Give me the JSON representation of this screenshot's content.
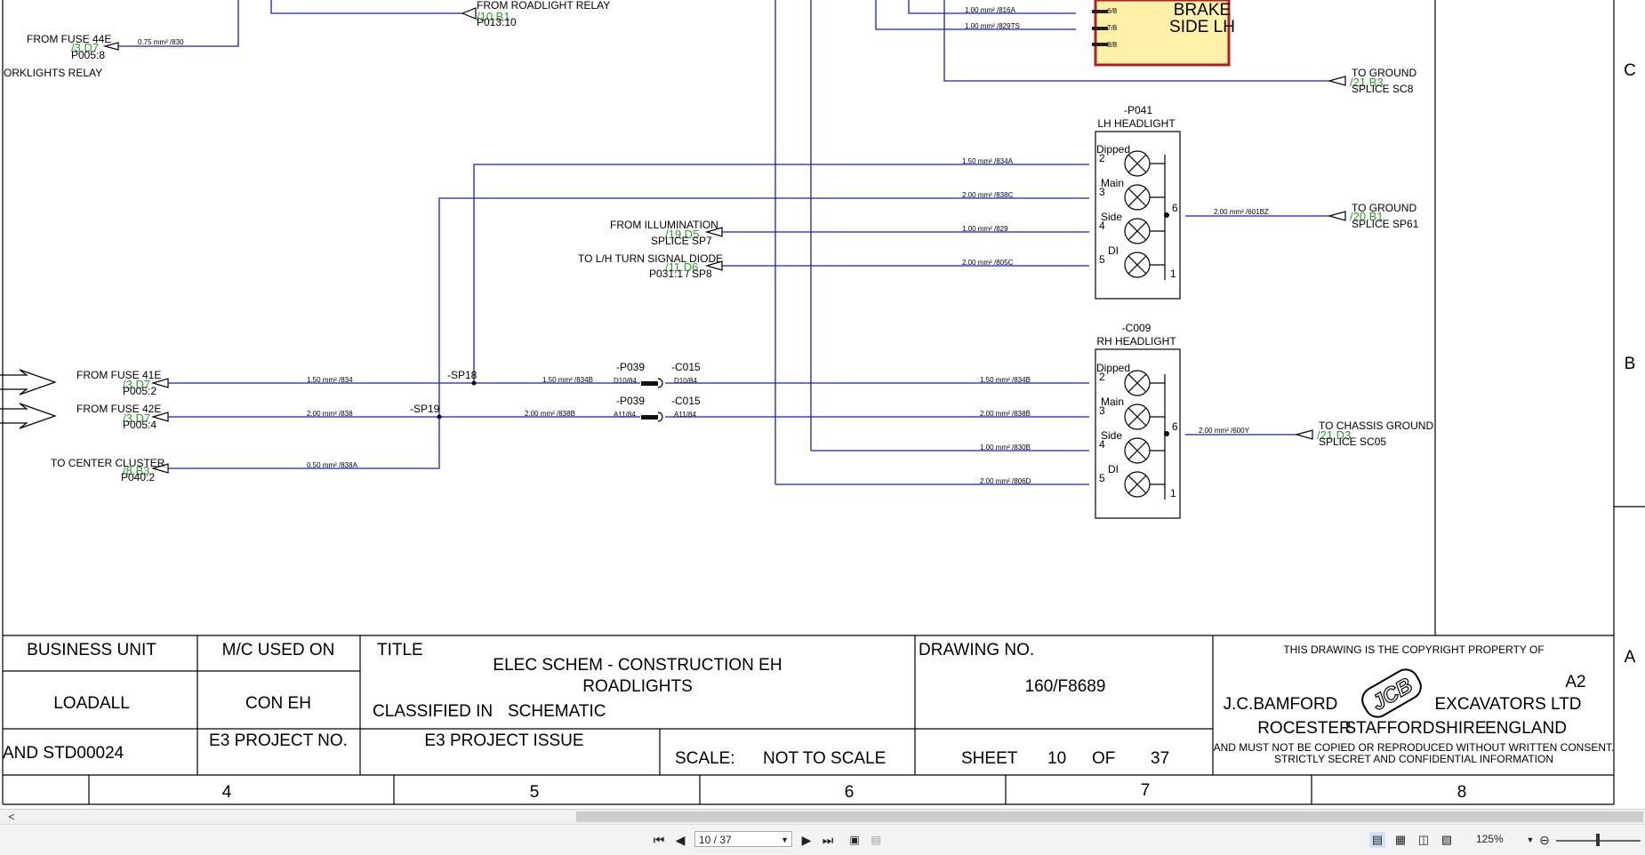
{
  "schematic": {
    "top_labels": {
      "from_roadlight_relay": "FROM ROADLIGHT RELAY",
      "roadlight_ref": "/10.B1",
      "roadlight_pin": "P013:10",
      "from_fuse_44e": "FROM FUSE 44E",
      "fuse44_ref": "/3.D7",
      "fuse44_pin": "P005:8",
      "fuse44_wire": "0.75 mm² /830",
      "worklights_relay": "ORKLIGHTS RELAY",
      "brake": "BRAKE",
      "side_lh": "SIDE LH",
      "pin_6_8": "6/8",
      "pin_7_8": "7/8",
      "pin_8_8": "8/8",
      "wire_816a": "1.00 mm² /816A",
      "wire_829ts": "1.00 mm² /829TS",
      "to_ground_1": "TO GROUND",
      "ground1_ref": "/21.B3",
      "ground1_splice": "SPLICE SC8"
    },
    "lh_headlight": {
      "ref": "-P041",
      "name": "LH HEADLIGHT",
      "pins": [
        {
          "name": "Dipped",
          "num": "2",
          "wire": "1.50 mm² /834A"
        },
        {
          "name": "Main",
          "num": "3",
          "wire": "2.00 mm² /838C"
        },
        {
          "name": "Side",
          "num": "4",
          "wire": "1.00 mm² /829"
        },
        {
          "name": "DI",
          "num": "5",
          "wire": "2.00 mm² /805C"
        }
      ],
      "out_pin": "6",
      "pin1": "1",
      "out_wire": "2.00 mm² /601BZ",
      "to_ground": "TO GROUND",
      "ground_ref": "/20.B1",
      "ground_splice": "SPLICE SP61",
      "from_illumination": "FROM ILLUMINATION",
      "illum_ref": "/19.D5",
      "illum_splice": "SPLICE SP7",
      "turn_signal": "TO L/H TURN SIGNAL DIODE",
      "turn_ref": "/11.D6",
      "turn_pin": "P031:1 / SP8"
    },
    "rh_headlight": {
      "ref": "-C009",
      "name": "RH HEADLIGHT",
      "pins": [
        {
          "name": "Dipped",
          "num": "2",
          "wire": "1.50 mm² /834B"
        },
        {
          "name": "Main",
          "num": "3",
          "wire": "2.00 mm² /838B"
        },
        {
          "name": "Side",
          "num": "4",
          "wire": "1.00 mm² /830B"
        },
        {
          "name": "DI",
          "num": "5",
          "wire": "2.00 mm² /806D"
        }
      ],
      "out_pin": "6",
      "pin1": "1",
      "out_wire": "2.00 mm² /600Y",
      "to_ground": "TO CHASSIS GROUND",
      "ground_ref": "/21.D3",
      "ground_splice": "SPLICE SC05"
    },
    "left_feeds": {
      "fuse41": "FROM FUSE 41E",
      "fuse41_ref": "/3.D7",
      "fuse41_pin": "P005:2",
      "fuse41_wire": "1.50 mm² /834",
      "fuse42": "FROM FUSE 42E",
      "fuse42_ref": "/3.D7",
      "fuse42_pin": "P005:4",
      "fuse42_wire": "2.00 mm² /838",
      "center_cluster": "TO CENTER CLUSTER",
      "cluster_ref": "/8.B3",
      "cluster_pin": "P040:2",
      "cluster_wire": "0.50 mm² /838A",
      "sp18": "-SP18",
      "sp19": "-SP19",
      "wire_834b": "1.50 mm² /834B",
      "wire_838b": "2.00 mm² /838B"
    },
    "connectors": {
      "p039_a": "-P039",
      "c015_a": "-C015",
      "p039_a_pin": "D10/84",
      "c015_a_pin": "D10/84",
      "p039_b": "-P039",
      "c015_b": "-C015",
      "p039_b_pin": "A11/84",
      "c015_b_pin": "A11/84"
    },
    "zone_letters": [
      "C",
      "B",
      "A"
    ],
    "column_numbers": [
      "4",
      "5",
      "6",
      "7",
      "8"
    ]
  },
  "title_block": {
    "business_unit_label": "BUSINESS UNIT",
    "business_unit_value": "LOADALL",
    "mc_used_on_label": "M/C USED ON",
    "mc_used_on_value": "CON EH",
    "title_label": "TITLE",
    "title_line1": "ELEC SCHEM - CONSTRUCTION EH",
    "title_line2": "ROADLIGHTS",
    "classified_in_label": "CLASSIFIED IN",
    "classified_in_value": "SCHEMATIC",
    "drawing_no_label": "DRAWING NO.",
    "drawing_no_value": "160/F8689",
    "standard": "AND STD00024",
    "e3_project_no": "E3 PROJECT NO.",
    "e3_project_issue": "E3 PROJECT ISSUE",
    "scale_label": "SCALE:",
    "scale_value": "NOT TO SCALE",
    "sheet_label": "SHEET",
    "sheet_num": "10",
    "of_label": "OF",
    "sheet_total": "37",
    "copyright_line": "THIS DRAWING IS THE COPYRIGHT PROPERTY OF",
    "size": "A2",
    "company_left": "J.C.BAMFORD",
    "company_right": "EXCAVATORS LTD",
    "logo_text": "JCB",
    "addr_town": "ROCESTER",
    "addr_county": "STAFFORDSHIRE",
    "addr_country": "ENGLAND",
    "notice1": "AND MUST NOT BE COPIED OR REPRODUCED WITHOUT WRITTEN CONSENT.",
    "notice2": "STRICTLY SECRET AND CONFIDENTIAL INFORMATION"
  },
  "viewer": {
    "page_indicator": "10 / 37",
    "zoom": "125%",
    "scroll_left_glyph": "<"
  }
}
